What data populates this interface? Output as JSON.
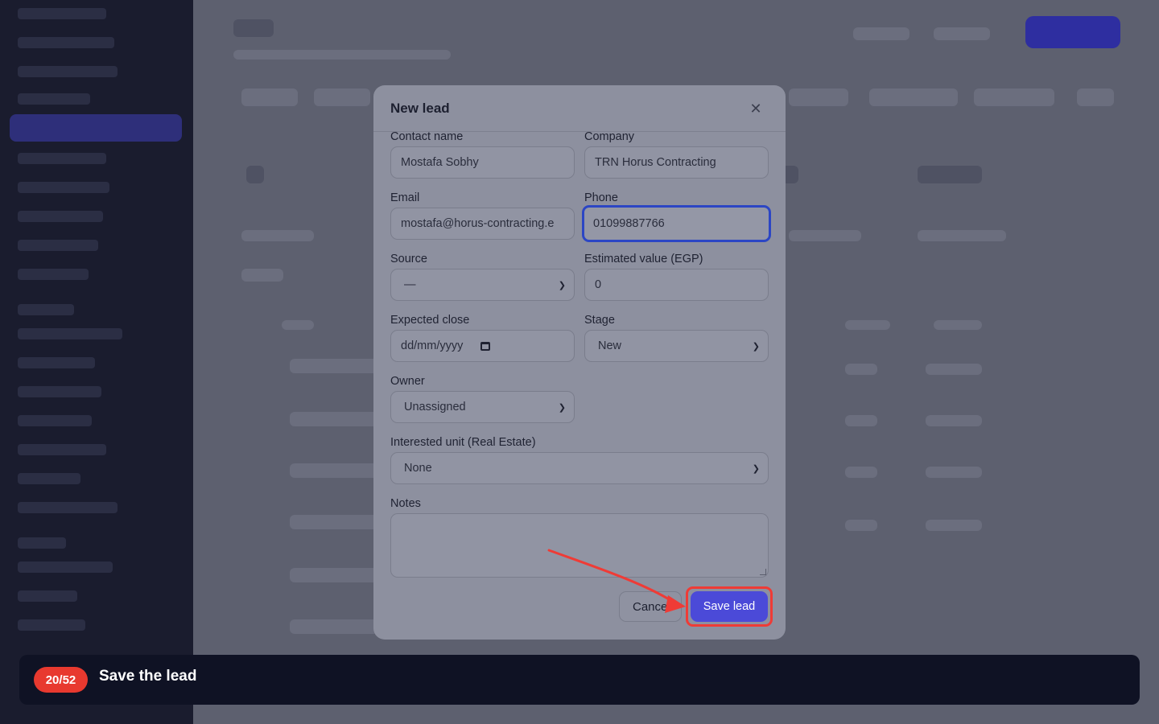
{
  "modal": {
    "title": "New lead",
    "close_icon": "close-icon",
    "fields": {
      "contact_name": {
        "label": "Contact name",
        "value": "Mostafa Sobhy"
      },
      "company": {
        "label": "Company",
        "value": "TRN Horus Contracting"
      },
      "email": {
        "label": "Email",
        "value": "mostafa@horus-contracting.e"
      },
      "phone": {
        "label": "Phone",
        "value": "01099887766"
      },
      "source": {
        "label": "Source",
        "value": "—"
      },
      "estimated_value": {
        "label": "Estimated value (EGP)",
        "value": "0"
      },
      "expected_close": {
        "label": "Expected close",
        "placeholder": "dd/mm/yyyy"
      },
      "stage": {
        "label": "Stage",
        "value": "New"
      },
      "owner": {
        "label": "Owner",
        "value": "Unassigned"
      },
      "interested_unit": {
        "label": "Interested unit (Real Estate)",
        "value": "None"
      },
      "notes": {
        "label": "Notes",
        "value": ""
      }
    },
    "buttons": {
      "cancel": "Cancel",
      "save": "Save lead"
    }
  },
  "tour": {
    "step": "20/52",
    "instruction": "Save the lead"
  },
  "colors": {
    "accent": "#4b4ad8",
    "highlight": "#ef3b36",
    "tour_bar": "#0f1224"
  }
}
